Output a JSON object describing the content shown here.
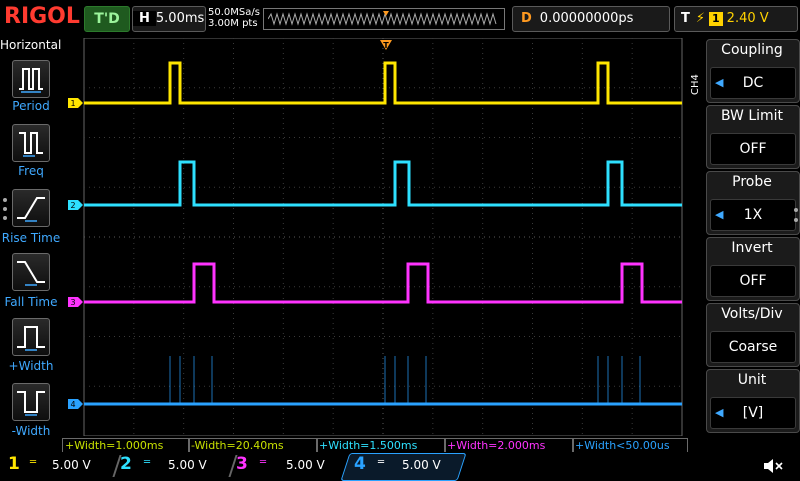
{
  "top": {
    "logo": "RIGOL",
    "trigger_status": "T'D",
    "timebase_key": "H",
    "timebase_value": "5.00ms",
    "sample_rate": "50.0MSa/s",
    "memory_depth": "3.00M pts",
    "delay_key": "D",
    "delay_value": "0.00000000ps",
    "trigger_key": "T",
    "trigger_source": "1",
    "trigger_level": "2.40 V"
  },
  "left_panel": {
    "title": "Horizontal",
    "buttons": [
      {
        "label": "Period",
        "icon": "period-icon"
      },
      {
        "label": "Freq",
        "icon": "freq-icon"
      },
      {
        "label": "Rise Time",
        "icon": "rise-time-icon"
      },
      {
        "label": "Fall Time",
        "icon": "fall-time-icon"
      },
      {
        "label": "+Width",
        "icon": "pos-width-icon"
      },
      {
        "label": "-Width",
        "icon": "neg-width-icon"
      }
    ]
  },
  "right_panel": {
    "channel_tag": "CH4",
    "menus": [
      {
        "title": "Coupling",
        "value": "DC"
      },
      {
        "title": "BW Limit",
        "value": "OFF"
      },
      {
        "title": "Probe",
        "value": "1X"
      },
      {
        "title": "Invert",
        "value": "OFF"
      },
      {
        "title": "Volts/Div",
        "value": "Coarse"
      },
      {
        "title": "Unit",
        "value": "[V]"
      }
    ]
  },
  "measurements": [
    {
      "text": "+Width=1.000ms",
      "color": "#c8e000"
    },
    {
      "text": "-Width=20.40ms",
      "color": "#c8e000"
    },
    {
      "text": "+Width=1.500ms",
      "color": "#2ee0ff"
    },
    {
      "text": "+Width=2.000ms",
      "color": "#ff33ff"
    },
    {
      "text": "+Width<50.00us",
      "color": "#2aa2ff"
    }
  ],
  "channels": [
    {
      "num": "1",
      "scale": "5.00 V",
      "color": "#ffe600"
    },
    {
      "num": "2",
      "scale": "5.00 V",
      "color": "#2ee0ff"
    },
    {
      "num": "3",
      "scale": "5.00 V",
      "color": "#ff33ff"
    },
    {
      "num": "4",
      "scale": "5.00 V",
      "color": "#2aa2ff"
    }
  ],
  "colors": {
    "ch1": "#ffe600",
    "ch2": "#2ee0ff",
    "ch3": "#ff33ff",
    "ch4": "#2aa2ff",
    "trigger_marker": "#ff9a20",
    "grid": "#555555"
  },
  "pulse_trains": {
    "period_ms": 20.4,
    "ch1_pulse_width_ms": 1.0,
    "ch2_pulse_width_ms": 1.5,
    "ch3_pulse_width_ms": 2.0,
    "ch4_pulse_width": "<50.00us"
  }
}
